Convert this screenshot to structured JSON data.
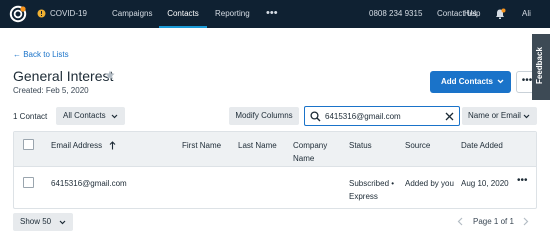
{
  "colors": {
    "nav_bg": "#0f2132",
    "accent": "#1a73c9",
    "active_underline": "#1a9ad6",
    "feedback_bg": "#3d4a55"
  },
  "nav": {
    "covid": "COVID-19",
    "campaigns": "Campaigns",
    "contacts": "Contacts",
    "reporting": "Reporting",
    "more": "•••",
    "phone": "0808 234 9315",
    "contact_us": "Contact Us",
    "help": "Help",
    "user": "Ali"
  },
  "header": {
    "back_link": "← Back to Lists",
    "title": "General Interest",
    "created": "Created: Feb 5, 2020",
    "add_contacts": "Add Contacts",
    "more": "•••",
    "feedback": "Feedback"
  },
  "toolbar": {
    "count": "1 Contact",
    "filter": "All Contacts",
    "modify_columns": "Modify Columns",
    "search_value": "6415316@gmail.com",
    "search_scope": "Name or Email"
  },
  "table": {
    "columns": {
      "email": "Email Address",
      "first_name": "First Name",
      "last_name": "Last Name",
      "company_line1": "Company",
      "company_line2": "Name",
      "status": "Status",
      "source": "Source",
      "date_added": "Date Added"
    },
    "rows": [
      {
        "email": "6415316@gmail.com",
        "first_name": "",
        "last_name": "",
        "company": "",
        "status_line1": "Subscribed •",
        "status_line2": "Express",
        "source": "Added by you",
        "date_added": "Aug 10, 2020",
        "more": "•••"
      }
    ]
  },
  "footer": {
    "page_size": "Show 50",
    "page_label": "Page 1 of 1"
  }
}
